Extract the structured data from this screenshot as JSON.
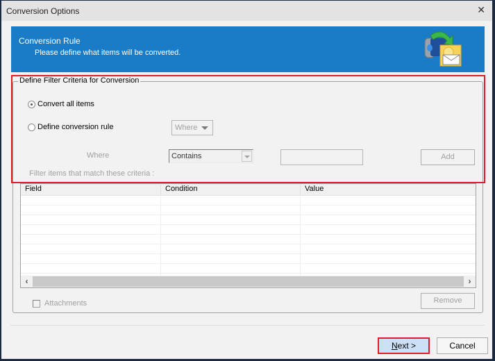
{
  "window": {
    "title": "Conversion Options",
    "close_glyph": "✕"
  },
  "banner": {
    "title": "Conversion Rule",
    "subtitle": "Please define what items will be converted.",
    "icon": "mailbox-to-envelope-conversion-icon",
    "background_color": "#1a7cc6"
  },
  "filter": {
    "legend": "Define Filter Criteria for Conversion",
    "options": [
      {
        "label": "Convert all items",
        "checked": true
      },
      {
        "label": "Define conversion rule",
        "checked": false
      }
    ],
    "where_combo": {
      "value": "Where",
      "enabled": false
    },
    "where_label": "Where",
    "condition_combo": {
      "value": "Contains",
      "enabled": false
    },
    "value_input": {
      "value": "",
      "enabled": false
    },
    "add_button": "Add",
    "filter_label": "Filter items that match these criteria :"
  },
  "table": {
    "columns": [
      "Field",
      "Condition",
      "Value"
    ],
    "rows": []
  },
  "attachments": {
    "label": "Attachments",
    "checked": false,
    "enabled": false
  },
  "remove_button": "Remove",
  "footer": {
    "next_label_accel": "N",
    "next_label_rest": "ext >",
    "cancel_label": "Cancel"
  },
  "highlight_color": "#e31b23"
}
